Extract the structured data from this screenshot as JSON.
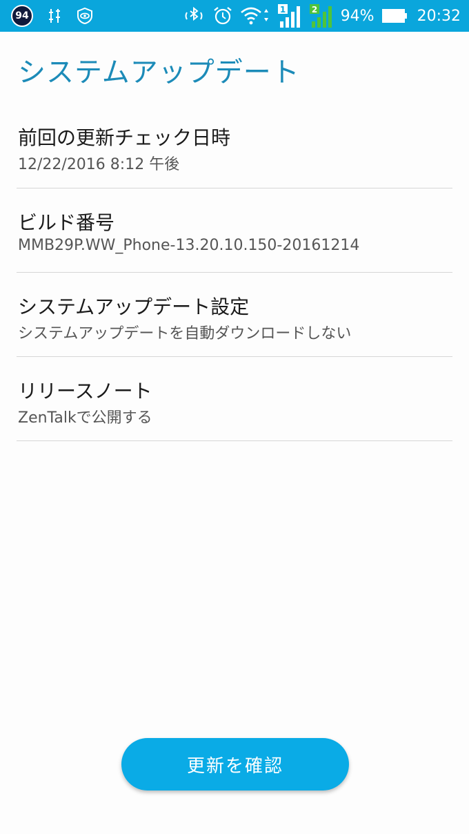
{
  "status_bar": {
    "notification_badge": "94",
    "battery_percent": "94%",
    "time": "20:32",
    "sim1": "1",
    "sim2": "2",
    "icons": [
      "badge-94-icon",
      "equalizer-icon",
      "eye-shield-icon",
      "bluetooth-icon",
      "alarm-icon",
      "wifi-icon",
      "signal-sim1-icon",
      "signal-sim2-icon",
      "battery-icon"
    ]
  },
  "page": {
    "title": "システムアップデート"
  },
  "items": [
    {
      "title": "前回の更新チェック日時",
      "subtitle": "12/22/2016 8:12 午後"
    },
    {
      "title": "ビルド番号",
      "subtitle": "MMB29P.WW_Phone-13.20.10.150-20161214"
    },
    {
      "title": "システムアップデート設定",
      "subtitle": "システムアップデートを自動ダウンロードしない"
    },
    {
      "title": "リリースノート",
      "subtitle": "ZenTalkで公開する"
    }
  ],
  "actions": {
    "check_update_label": "更新を確認"
  },
  "colors": {
    "status_bar": "#0aa6dc",
    "title": "#1c8bb8",
    "button": "#0aabe6"
  }
}
